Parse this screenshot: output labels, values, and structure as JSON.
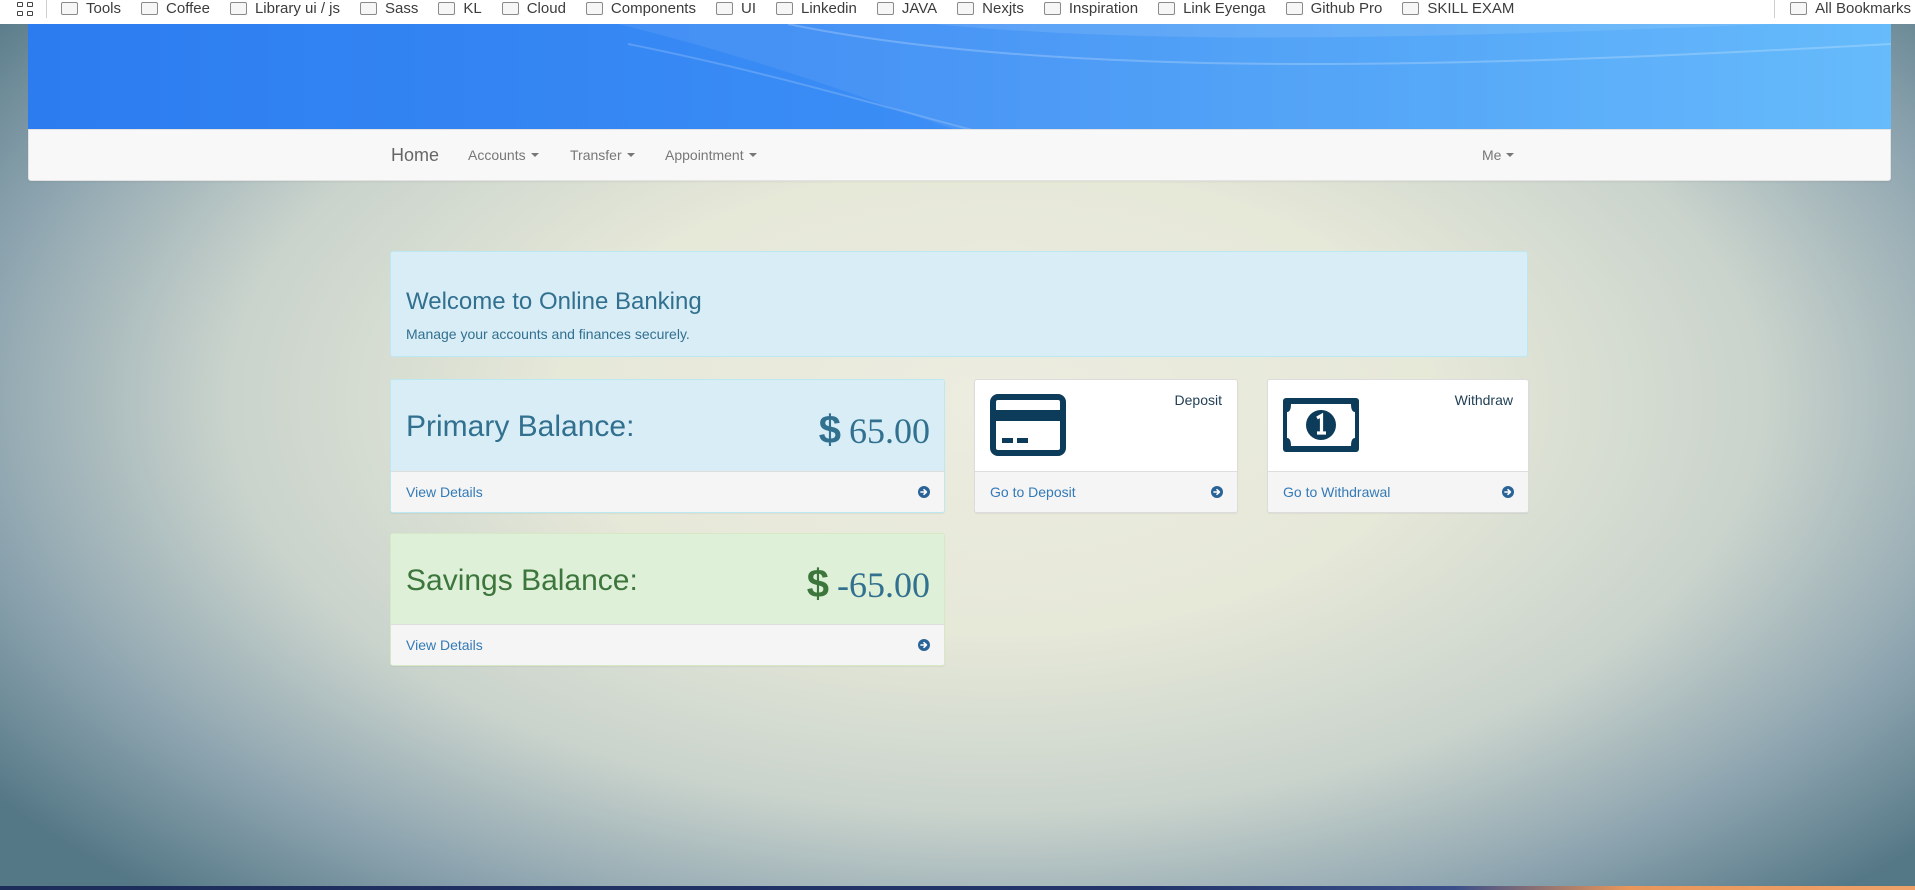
{
  "bookmarks": {
    "items": [
      "Tools",
      "Coffee",
      "Library ui / js",
      "Sass",
      "KL",
      "Cloud",
      "Components",
      "UI",
      "Linkedin",
      "JAVA",
      "Nexjts",
      "Inspiration",
      "Link Eyenga",
      "Github Pro",
      "SKILL EXAM"
    ],
    "all_label": "All Bookmarks"
  },
  "nav": {
    "brand": "Home",
    "accounts": "Accounts",
    "transfer": "Transfer",
    "appointment": "Appointment",
    "me": "Me"
  },
  "welcome": {
    "title": "Welcome to Online Banking",
    "subtitle": "Manage your accounts and finances securely."
  },
  "primary": {
    "label": "Primary Balance:",
    "currency": "$",
    "amount": "65.00",
    "link": "View Details"
  },
  "savings": {
    "label": "Savings Balance:",
    "currency": "$",
    "amount": "-65.00",
    "link": "View Details"
  },
  "deposit": {
    "title": "Deposit",
    "link": "Go to Deposit"
  },
  "withdraw": {
    "title": "Withdraw",
    "link": "Go to Withdrawal"
  },
  "colors": {
    "info_bg": "#d9edf7",
    "info_text": "#31708f",
    "success_bg": "#dff0d8",
    "success_text": "#3c763d",
    "link": "#337ab7",
    "icon_dark": "#0d3c5a",
    "banner": "#2c7cf0"
  },
  "icons": {
    "apps": "apps-grid-icon",
    "folder": "folder-icon",
    "deposit": "credit-card-icon",
    "withdraw": "money-bill-icon",
    "footer_arrow": "arrow-circle-right-icon"
  }
}
